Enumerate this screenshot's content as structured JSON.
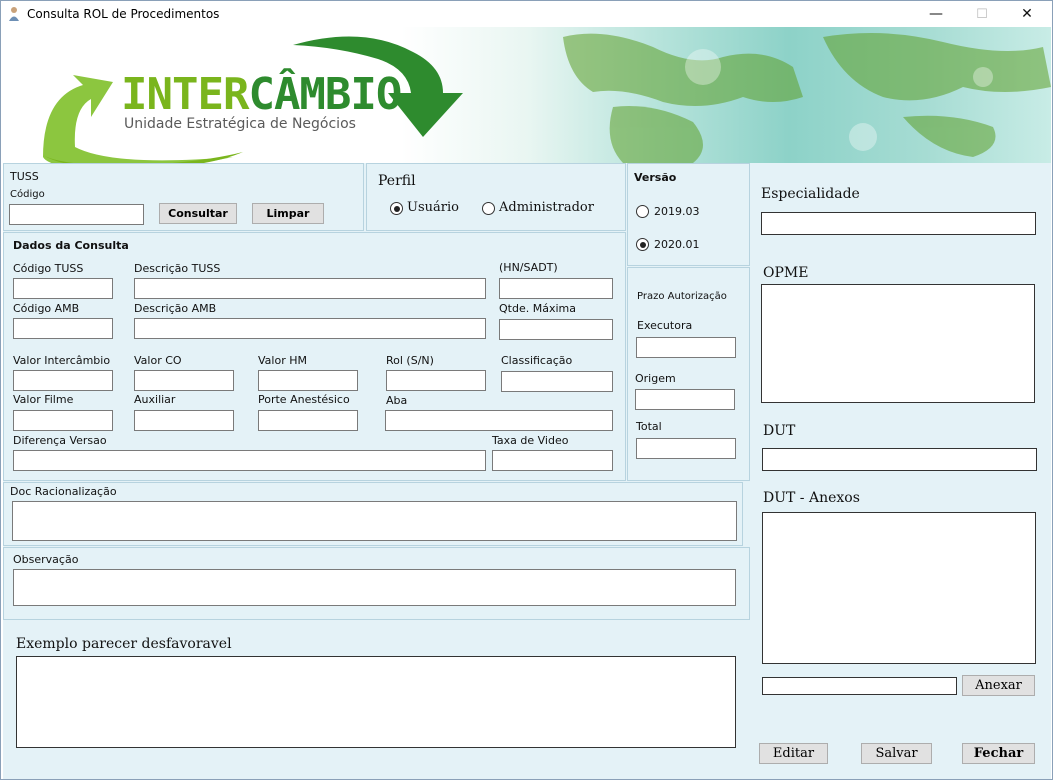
{
  "window": {
    "title": "Consulta ROL de Procedimentos",
    "minimize_glyph": "—",
    "maximize_glyph": "☐",
    "close_glyph": "✕"
  },
  "banner": {
    "brand_part1": "INTER",
    "brand_part2": "CÂMBIO",
    "tagline": "Unidade Estratégica de Negócios"
  },
  "tuss": {
    "section_label": "TUSS",
    "code_label": "Código",
    "code_value": "",
    "consult_button": "Consultar",
    "clear_button": "Limpar"
  },
  "perfil": {
    "label": "Perfil",
    "options": [
      {
        "label": "Usuário",
        "selected": true
      },
      {
        "label": "Administrador",
        "selected": false
      }
    ]
  },
  "versao": {
    "label": "Versão",
    "options": [
      {
        "label": "2019.03",
        "selected": false
      },
      {
        "label": "2020.01",
        "selected": true
      }
    ]
  },
  "dados": {
    "section_label": "Dados da Consulta",
    "codigo_tuss": "Código TUSS",
    "descricao_tuss": "Descrição TUSS",
    "hn_sadt": "(HN/SADT)",
    "codigo_amb": "Código AMB",
    "descricao_amb": "Descrição AMB",
    "qtde_maxima": "Qtde. Máxima",
    "valor_intercambio": "Valor Intercâmbio",
    "valor_co": "Valor CO",
    "valor_hm": "Valor HM",
    "rol_sn": "Rol (S/N)",
    "classificacao": "Classificação",
    "valor_filme": "Valor Filme",
    "auxiliar": "Auxiliar",
    "porte_anestesico": "Porte Anestésico",
    "aba": "Aba",
    "diferenca_versao": "Diferença Versao",
    "taxa_video": "Taxa de Video"
  },
  "prazo": {
    "label": "Prazo Autorização",
    "executora": "Executora",
    "origem": "Origem",
    "total": "Total"
  },
  "doc_racionalizacao": "Doc Racionalização",
  "observacao": "Observação",
  "exemplo_parecer": "Exemplo parecer desfavoravel",
  "right": {
    "especialidade": "Especialidade",
    "opme": "OPME",
    "dut": "DUT",
    "dut_anexos": "DUT - Anexos",
    "anexar_button": "Anexar",
    "editar_button": "Editar",
    "salvar_button": "Salvar",
    "fechar_button": "Fechar"
  },
  "colors": {
    "panel_bg": "#e4f2f7",
    "panel_border": "#b7d3df",
    "brand_green": "#7ab51d",
    "brand_dark_green": "#2e8b2e"
  }
}
